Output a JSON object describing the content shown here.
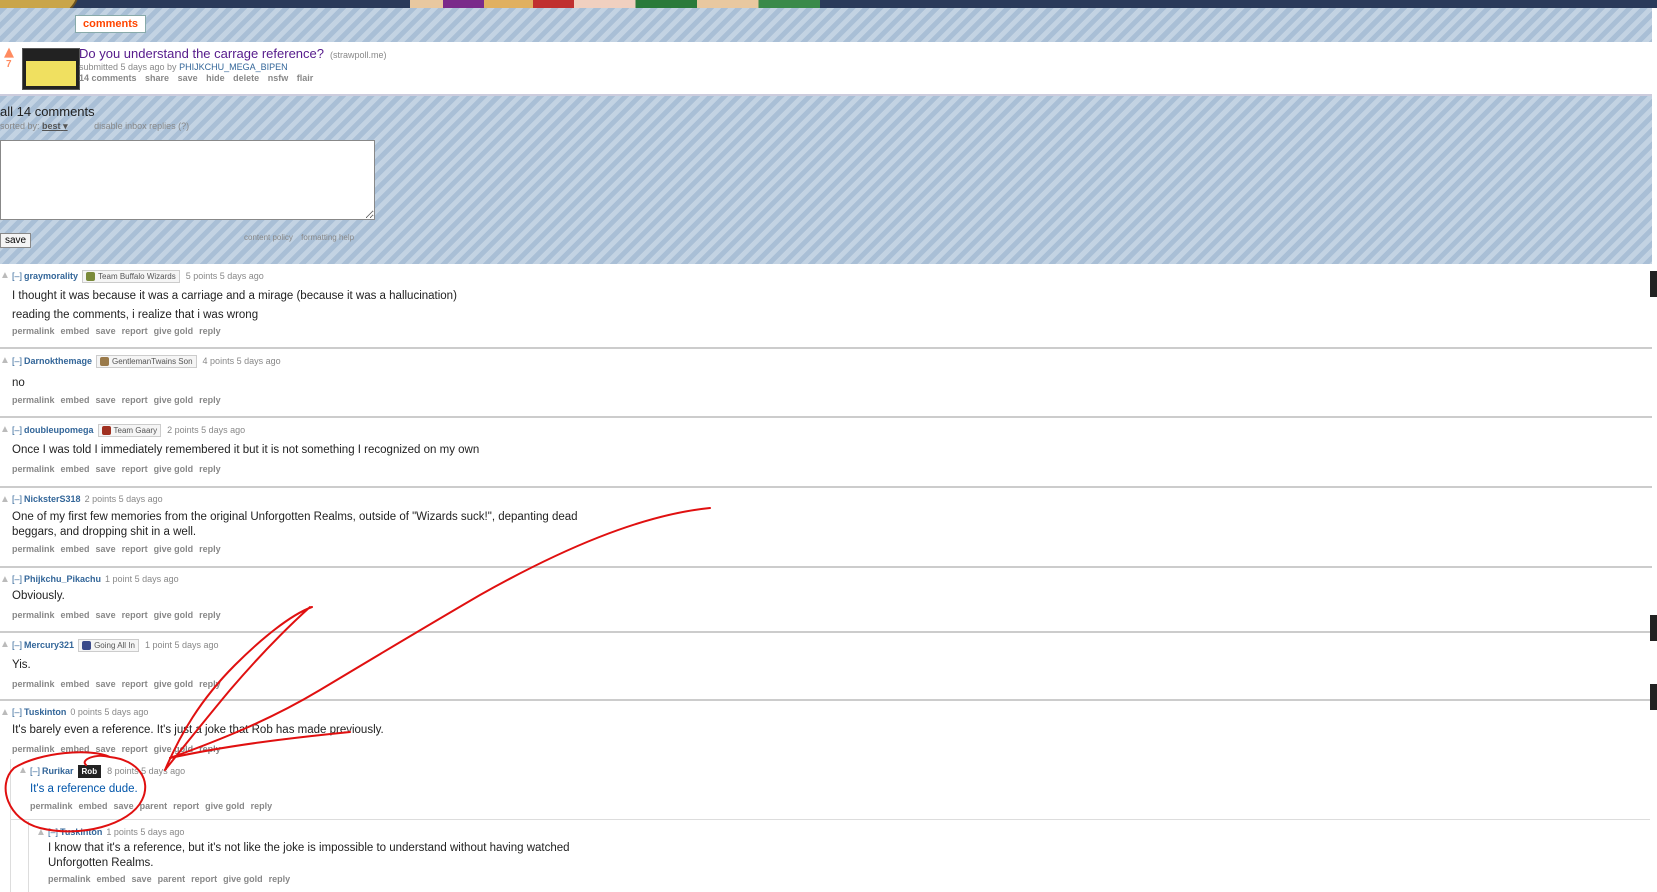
{
  "header": {
    "tab_label": "comments"
  },
  "post": {
    "score": "7",
    "title": "Do you understand the carrage reference?",
    "domain": "(strawpoll.me)",
    "submitted_prefix": "submitted 5 days ago by",
    "author": "PHIJKCHU_MEGA_BIPEN",
    "buttons": [
      "14 comments",
      "share",
      "save",
      "hide",
      "delete",
      "nsfw",
      "flair"
    ]
  },
  "comment_area": {
    "all_comments": "all 14 comments",
    "sorted_label": "sorted by:",
    "sorted_value": "best",
    "disable_inbox": "disable inbox replies (?)",
    "save_label": "save",
    "content_policy": "content policy",
    "formatting_help": "formatting help"
  },
  "comments": [
    {
      "toggle": "[–]",
      "user": "graymorality",
      "flair": "Team Buffalo Wizards",
      "meta": "5 points 5 days ago",
      "body": [
        "I thought it was because it was a carriage and a mirage (because it was a hallucination)",
        "reading the comments, i realize that i was wrong"
      ]
    },
    {
      "toggle": "[–]",
      "user": "Darnokthemage",
      "flair": "GentlemanTwains Son",
      "meta": "4 points 5 days ago",
      "body": [
        "no"
      ]
    },
    {
      "toggle": "[–]",
      "user": "doubleupomega",
      "flair": "Team Gaary",
      "meta": "2 points 5 days ago",
      "body": [
        "Once I was told I immediately remembered it but it is not something I recognized on my own"
      ]
    },
    {
      "toggle": "[–]",
      "user": "NicksterS318",
      "flair": "",
      "meta": "2 points 5 days ago",
      "body": [
        "One of my first few memories from the original Unforgotten Realms, outside of \"Wizards suck!\", depanting dead",
        "beggars, and dropping shit in a well."
      ]
    },
    {
      "toggle": "[–]",
      "user": "Phijkchu_Pikachu",
      "flair": "",
      "meta": "1 point 5 days ago",
      "body": [
        "Obviously."
      ]
    },
    {
      "toggle": "[–]",
      "user": "Mercury321",
      "flair": "Going All In",
      "meta": "1 point 5 days ago",
      "body": [
        "Yis."
      ]
    },
    {
      "toggle": "[–]",
      "user": "Tuskinton",
      "flair": "",
      "meta": "0 points 5 days ago",
      "body": [
        "It's barely even a reference. It's just a joke that Rob has made previously."
      ]
    },
    {
      "toggle": "[–]",
      "user": "Rurikar",
      "flair": "Rob",
      "meta": "8 points 5 days ago",
      "body": [
        "It's a reference dude."
      ]
    },
    {
      "toggle": "[–]",
      "user": "Tuskinton",
      "flair": "",
      "meta": "1 points 5 days ago",
      "body": [
        "I know that it's a reference, but it's not like the joke is impossible to understand without having watched",
        "Unforgotten Realms."
      ]
    }
  ],
  "actions": {
    "standard": [
      "permalink",
      "embed",
      "save",
      "report",
      "give gold",
      "reply"
    ],
    "child": [
      "permalink",
      "embed",
      "save",
      "parent",
      "report",
      "give gold",
      "reply"
    ]
  },
  "annotation": {
    "stroke_color": "#e01010"
  }
}
